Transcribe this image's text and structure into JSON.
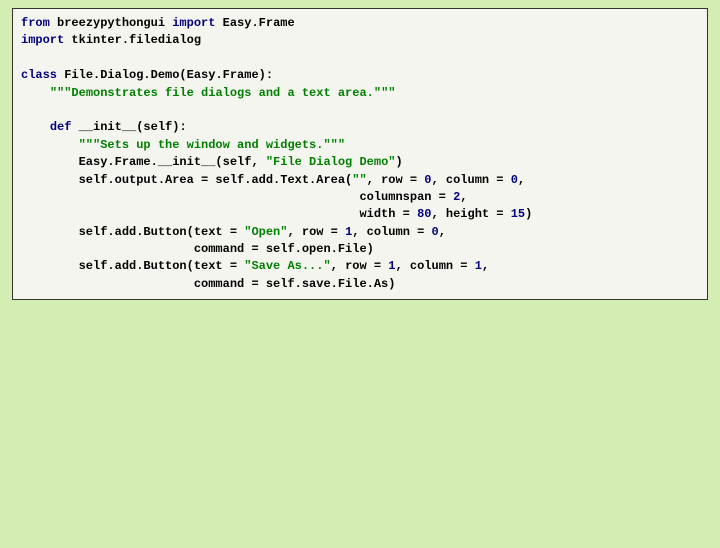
{
  "code": {
    "l1": {
      "a": "from",
      "b": " breezypythongui ",
      "c": "import",
      "d": " Easy.Frame"
    },
    "l2": {
      "a": "import",
      "b": " tkinter.filedialog"
    },
    "l3": "",
    "l4": {
      "a": "class",
      "b": " File.Dialog.Demo(Easy.Frame):"
    },
    "l5": {
      "a": "    ",
      "b": "\"\"\"Demonstrates file dialogs and a text area.\"\"\""
    },
    "l6": "",
    "l7": {
      "a": "    ",
      "b": "def",
      "c": " __init__(self):"
    },
    "l8": {
      "a": "        ",
      "b": "\"\"\"Sets up the window and widgets.\"\"\""
    },
    "l9": {
      "a": "        Easy.Frame.__init__(self, ",
      "b": "\"File Dialog Demo\"",
      "c": ")"
    },
    "l10": {
      "a": "        self.output.Area = self.add.Text.Area(",
      "b": "\"\"",
      "c": ", row = ",
      "d": "0",
      "e": ", column = ",
      "f": "0",
      "g": ","
    },
    "l11": {
      "a": "                                               columnspan = ",
      "b": "2",
      "c": ","
    },
    "l12": {
      "a": "                                               width = ",
      "b": "80",
      "c": ", height = ",
      "d": "15",
      "e": ")"
    },
    "l13": {
      "a": "        self.add.Button(text = ",
      "b": "\"Open\"",
      "c": ", row = ",
      "d": "1",
      "e": ", column = ",
      "f": "0",
      "g": ","
    },
    "l14": {
      "a": "                        command = self.open.File)"
    },
    "l15": {
      "a": "        self.add.Button(text = ",
      "b": "\"Save As...\"",
      "c": ", row = ",
      "d": "1",
      "e": ", column = ",
      "f": "1",
      "g": ","
    },
    "l16": {
      "a": "                        command = self.save.File.As)"
    }
  }
}
